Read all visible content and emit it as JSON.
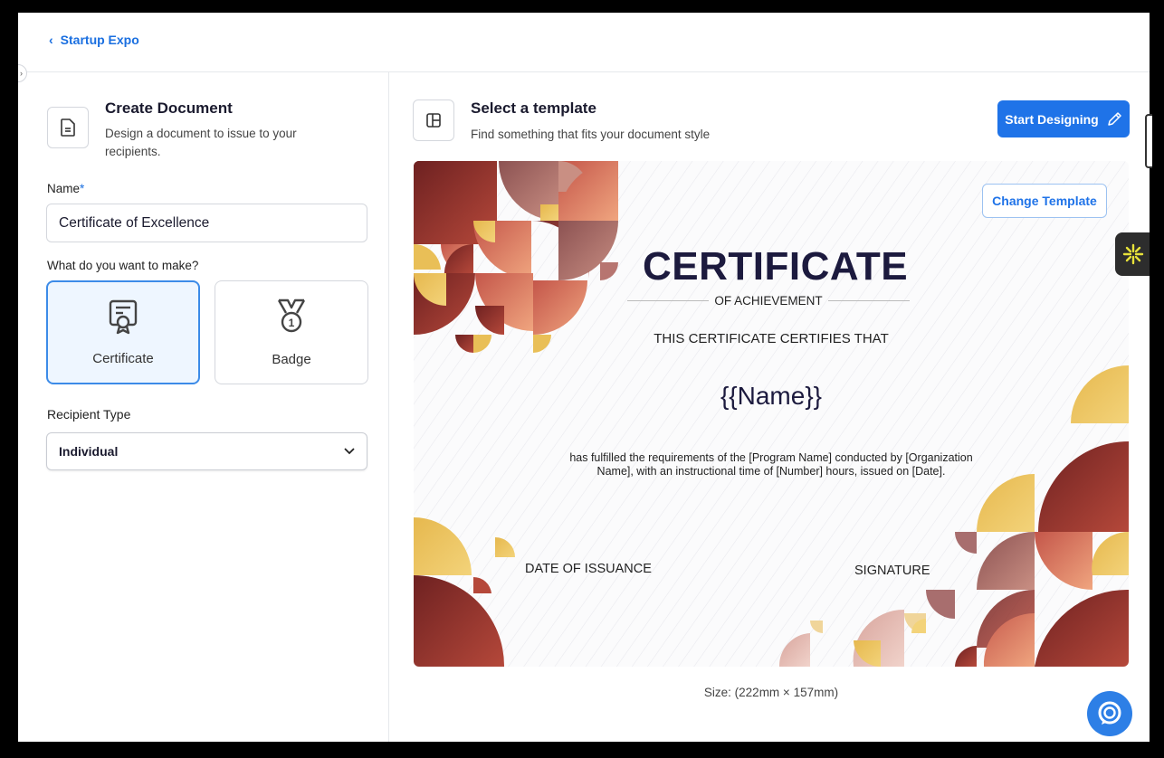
{
  "topbar": {
    "back_label": "Startup Expo"
  },
  "create": {
    "title": "Create Document",
    "description": "Design a document to issue to your recipients."
  },
  "form": {
    "name_label": "Name",
    "name_required_mark": "*",
    "name_value": "Certificate of Excellence",
    "make_label": "What do you want to make?",
    "types": [
      {
        "label": "Certificate",
        "selected": true
      },
      {
        "label": "Badge",
        "selected": false
      }
    ],
    "recipient_label": "Recipient Type",
    "recipient_value": "Individual"
  },
  "template": {
    "title": "Select a template",
    "description": "Find something that fits your document style",
    "start_button": "Start Designing",
    "change_button": "Change Template",
    "size_text": "Size: (222mm × 157mm)"
  },
  "certificate": {
    "heading": "CERTIFICATE",
    "subheading": "OF ACHIEVEMENT",
    "certifies": "THIS CERTIFICATE CERTIFIES THAT",
    "name_placeholder": "{{Name}}",
    "body": "has fulfilled the requirements of the [Program Name] conducted by [Organization Name], with an instructional time of [Number] hours, issued on [Date].",
    "date_label": "DATE OF ISSUANCE",
    "signature_label": "SIGNATURE"
  },
  "colors": {
    "accent": "#1f73e8",
    "maroon": "#7d2b2b",
    "rust": "#b5483a",
    "salmon": "#e08a6a",
    "gold": "#e8c25a",
    "mauve": "#a86e6e"
  },
  "icons": {
    "back": "chevron-left-icon",
    "document": "document-icon",
    "certificate": "certificate-icon",
    "badge": "medal-icon",
    "dropdown": "chevron-down-icon",
    "template": "layout-icon",
    "pen": "pen-icon",
    "chat": "chat-icon",
    "extension": "sparkle-icon"
  }
}
